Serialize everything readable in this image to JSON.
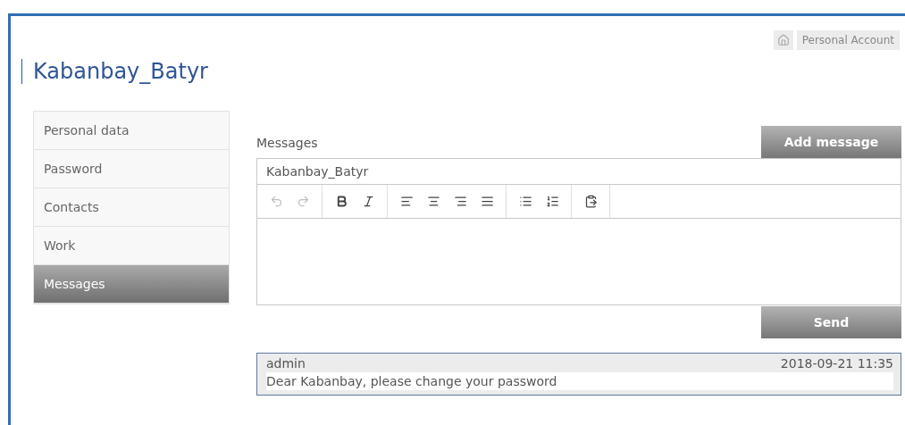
{
  "header": {
    "account_link": "Personal Account"
  },
  "title": "Kabanbay_Batyr",
  "sidebar": {
    "items": [
      {
        "label": "Personal data",
        "selected": false
      },
      {
        "label": "Password",
        "selected": false
      },
      {
        "label": "Contacts",
        "selected": false
      },
      {
        "label": "Work",
        "selected": false
      },
      {
        "label": "Messages",
        "selected": true
      }
    ]
  },
  "messages": {
    "heading": "Messages",
    "add_button": "Add message",
    "editor": {
      "recipient": "Kabanbay_Batyr",
      "toolbar": [
        [
          {
            "kind": "undo",
            "disabled": true
          },
          {
            "kind": "redo",
            "disabled": true
          }
        ],
        [
          {
            "kind": "bold",
            "disabled": false
          },
          {
            "kind": "italic",
            "disabled": false
          }
        ],
        [
          {
            "kind": "align-left",
            "disabled": false
          },
          {
            "kind": "align-center",
            "disabled": false
          },
          {
            "kind": "align-right",
            "disabled": false
          },
          {
            "kind": "align-justify",
            "disabled": false
          }
        ],
        [
          {
            "kind": "bullet-list",
            "disabled": false
          },
          {
            "kind": "numbered-list",
            "disabled": false
          }
        ],
        [
          {
            "kind": "paste",
            "disabled": false
          }
        ]
      ]
    },
    "send_button": "Send",
    "items": [
      {
        "author": "admin",
        "time": "2018-09-21 11:35",
        "text": "Dear Kabanbay, please change your password"
      }
    ]
  }
}
